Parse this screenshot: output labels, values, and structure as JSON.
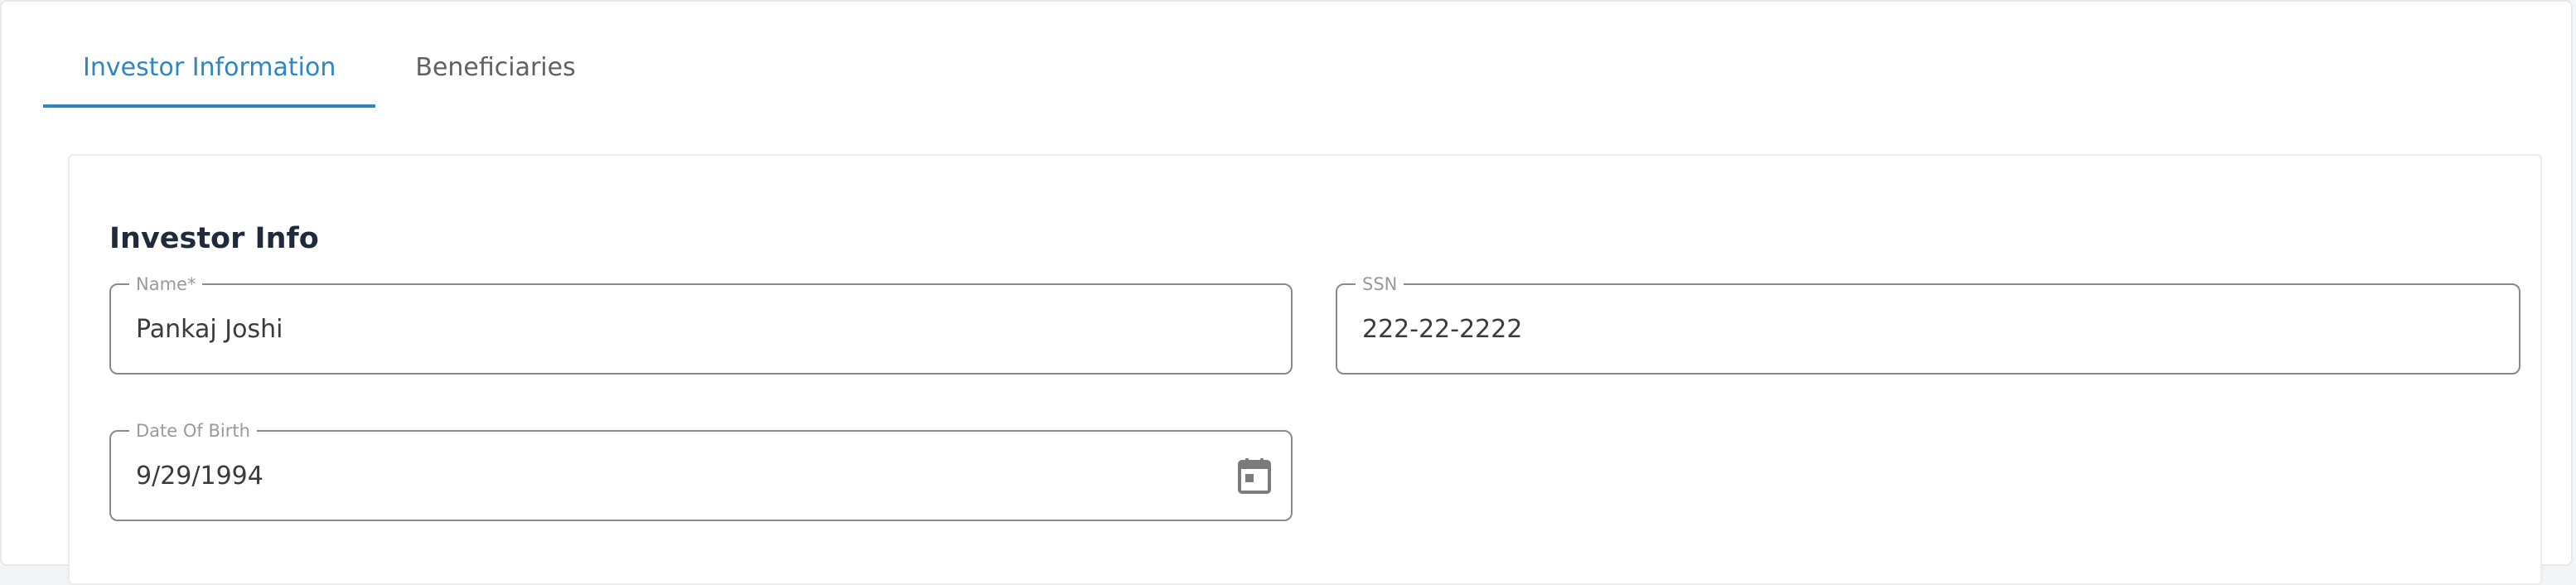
{
  "tabs": [
    {
      "label": "Investor Information",
      "active": true
    },
    {
      "label": "Beneficiaries",
      "active": false
    }
  ],
  "section": {
    "title": "Investor Info"
  },
  "fields": {
    "name": {
      "label": "Name*",
      "value": "Pankaj Joshi"
    },
    "ssn": {
      "label": "SSN",
      "value": "222-22-2222"
    },
    "dob": {
      "label": "Date Of Birth",
      "value": "9/29/1994",
      "icon": "calendar-icon"
    }
  },
  "colors": {
    "accent": "#2f86c0",
    "title": "#1f2b3d",
    "border": "#8a8a8a"
  }
}
